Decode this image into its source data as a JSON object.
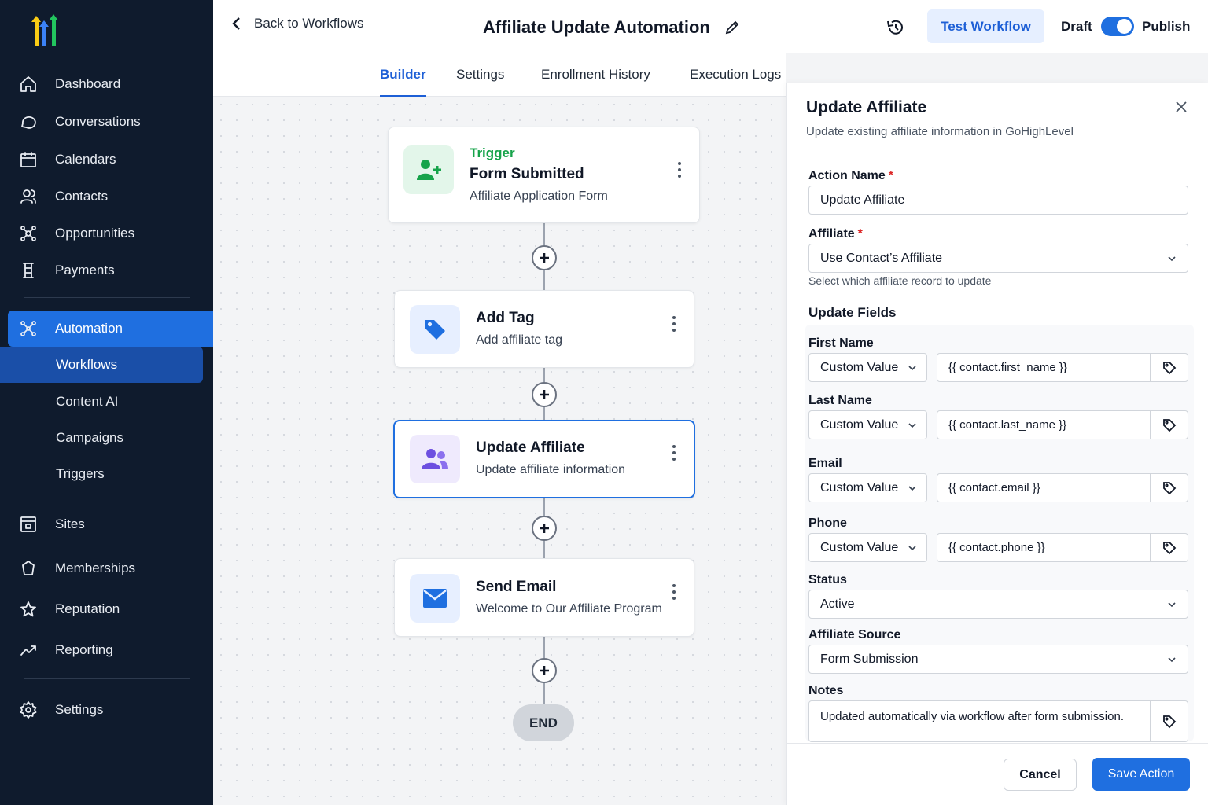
{
  "sidebar": {
    "items": [
      {
        "label": "Dashboard",
        "icon": "home-icon"
      },
      {
        "label": "Conversations",
        "icon": "chat-bubble-icon"
      },
      {
        "label": "Calendars",
        "icon": "calendar-icon"
      },
      {
        "label": "Contacts",
        "icon": "contacts-icon"
      },
      {
        "label": "Opportunities",
        "icon": "opportunities-icon"
      },
      {
        "label": "Payments",
        "icon": "payments-icon"
      }
    ],
    "automation": {
      "label": "Automation",
      "icon": "automation-icon"
    },
    "sub_items": [
      "Workflows",
      "Content AI",
      "Campaigns",
      "Triggers"
    ],
    "lower_items": [
      {
        "label": "Sites",
        "icon": "sites-icon"
      },
      {
        "label": "Memberships",
        "icon": "memberships-icon"
      },
      {
        "label": "Reputation",
        "icon": "star-icon"
      },
      {
        "label": "Reporting",
        "icon": "trend-icon"
      }
    ],
    "settings": {
      "label": "Settings",
      "icon": "gear-icon"
    }
  },
  "header": {
    "back_label": "Back to Workflows",
    "title": "Affiliate Update Automation",
    "test_label": "Test Workflow",
    "draft_label": "Draft",
    "publish_label": "Publish",
    "publish_toggle_on": true
  },
  "tabs": [
    "Builder",
    "Settings",
    "Enrollment History",
    "Execution Logs"
  ],
  "active_tab": "Builder",
  "workflow": {
    "nodes": [
      {
        "label": "Trigger",
        "title": "Form Submitted",
        "subtitle": "Affiliate Application Form",
        "icon": "user-plus-icon"
      },
      {
        "title": "Add Tag",
        "subtitle": "Add affiliate tag",
        "icon": "tag-icon"
      },
      {
        "title": "Update Affiliate",
        "subtitle": "Update affiliate information",
        "icon": "users-icon"
      },
      {
        "title": "Send Email",
        "subtitle": "Welcome to Our Affiliate Program",
        "icon": "mail-icon"
      }
    ],
    "end_label": "END"
  },
  "panel": {
    "title": "Update Affiliate",
    "subtitle": "Update existing affiliate information in GoHighLevel",
    "action_name_label": "Action Name",
    "action_name_value": "Update Affiliate",
    "affiliate_label": "Affiliate",
    "affiliate_value": "Use Contact’s Affiliate",
    "affiliate_help": "Select which affiliate record to update",
    "update_fields_title": "Update Fields",
    "fields": [
      {
        "label": "First Name",
        "mode": "Custom Value",
        "value": "{{ contact.first_name }}"
      },
      {
        "label": "Last Name",
        "mode": "Custom Value",
        "value": "{{ contact.last_name }}"
      },
      {
        "label": "Email",
        "mode": "Custom Value",
        "value": "{{ contact.email }}"
      },
      {
        "label": "Phone",
        "mode": "Custom Value",
        "value": "{{ contact.phone }}"
      }
    ],
    "status_label": "Status",
    "status_value": "Active",
    "source_label": "Affiliate Source",
    "source_value": "Form Submission",
    "notes_label": "Notes",
    "notes_value": "Updated automatically via workflow after form submission.",
    "cancel_label": "Cancel",
    "save_label": "Save Action"
  },
  "colors": {
    "sidebar_bg": "#0f1b2d",
    "accent": "#1f6fe0",
    "trigger_green": "#16a34a"
  }
}
